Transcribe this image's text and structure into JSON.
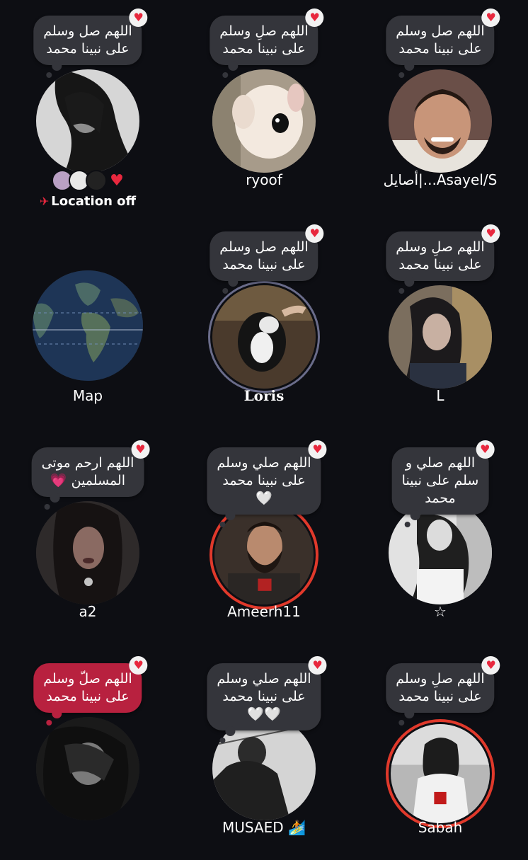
{
  "grid": [
    {
      "name": "أصايل|...Asayel/S",
      "bubble": [
        "اللهم صل وسلم",
        "على نبينا محمد"
      ]
    },
    {
      "name": "ryoof",
      "bubble": [
        "اللهم صلِ وسلم",
        "على نبينا محمد"
      ]
    },
    {
      "name": "",
      "bubble": [
        "اللهم صل وسلم",
        "على نبينا محمد"
      ],
      "status": "Location off"
    },
    {
      "name": "L",
      "bubble": [
        "اللهم صلِ وسلم",
        "على نبينا محمد"
      ]
    },
    {
      "name": "Loris",
      "bubble": [
        "اللهم صل وسلم",
        "على نبينا محمد"
      ]
    },
    {
      "name": "Map"
    },
    {
      "name": "☆",
      "bubble": [
        "اللهم صلي و",
        "سلم على نبينا",
        "محمد"
      ]
    },
    {
      "name": "Ameerh11",
      "bubble": [
        "اللهم صلي وسلم",
        "على نبينا محمد",
        "🤍"
      ]
    },
    {
      "name": "a2",
      "bubble": [
        "اللهم ارحم موتى",
        "المسلمين 💗"
      ]
    },
    {
      "name": "Sabah",
      "bubble": [
        "اللهم صلِ وسلم",
        "على نبينا محمد"
      ]
    },
    {
      "name": "MUSAED 🏄",
      "bubble": [
        "اللهم صلي وسلم",
        "على نبينا محمد",
        "🤍🤍"
      ]
    },
    {
      "name": "",
      "bubble": [
        "اللهم صلّ وسلم",
        "على نبينا محمد"
      ]
    }
  ],
  "icons": {
    "heart": "heart-icon",
    "plane": "airplane-icon",
    "globe": "globe-icon"
  },
  "colors": {
    "background": "#0d0e13",
    "bubble": "#34353b",
    "bubble_highlight": "#b8213f",
    "heart": "#e8283e",
    "ring_red": "#e0392b"
  }
}
